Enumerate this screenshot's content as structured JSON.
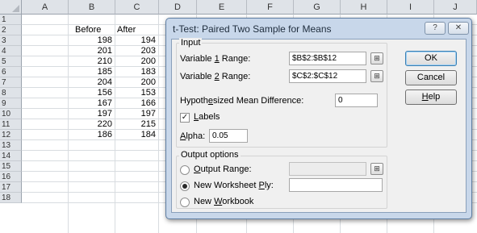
{
  "sheet": {
    "columns": [
      "A",
      "B",
      "C",
      "D",
      "E",
      "F",
      "G",
      "H",
      "I",
      "J"
    ],
    "rows": [
      "1",
      "2",
      "3",
      "4",
      "5",
      "6",
      "7",
      "8",
      "9",
      "10",
      "11",
      "12",
      "13",
      "14",
      "15",
      "16",
      "17",
      "18"
    ],
    "headers": {
      "before": "Before",
      "after": "After"
    },
    "before": [
      "198",
      "201",
      "210",
      "185",
      "204",
      "156",
      "167",
      "197",
      "220",
      "186"
    ],
    "after": [
      "194",
      "203",
      "200",
      "183",
      "200",
      "153",
      "166",
      "197",
      "215",
      "184"
    ]
  },
  "dialog": {
    "title": "t-Test: Paired Two Sample for Means",
    "help_glyph": "?",
    "close_glyph": "✕",
    "input_group": "Input",
    "var1_label_pre": "Variable ",
    "var1_label_key": "1",
    "var1_label_post": " Range:",
    "var1_value": "$B$2:$B$12",
    "var2_label_pre": "Variable ",
    "var2_label_key": "2",
    "var2_label_post": " Range:",
    "var2_value": "$C$2:$C$12",
    "hyp_label_pre": "Hypoth",
    "hyp_label_key": "e",
    "hyp_label_post": "sized Mean Difference:",
    "hyp_value": "0",
    "labels_key": "L",
    "labels_post": "abels",
    "labels_checked": "✓",
    "alpha_key": "A",
    "alpha_post": "lpha:",
    "alpha_value": "0.05",
    "output_group": "Output options",
    "out_range_key": "O",
    "out_range_post": "utput Range:",
    "out_range_value": "",
    "new_ws_pre": "New Worksheet ",
    "new_ws_key": "P",
    "new_ws_post": "ly:",
    "new_ws_value": "",
    "new_wb_pre": "New ",
    "new_wb_key": "W",
    "new_wb_post": "orkbook",
    "ok": "OK",
    "cancel": "Cancel",
    "help_key": "H",
    "help_post": "elp",
    "collapse_glyph": "⊞"
  }
}
